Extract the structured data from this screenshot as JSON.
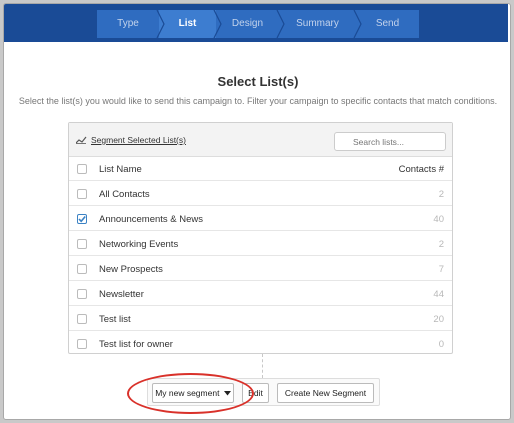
{
  "wizard": {
    "steps": [
      {
        "label": "Type"
      },
      {
        "label": "List"
      },
      {
        "label": "Design"
      },
      {
        "label": "Summary"
      },
      {
        "label": "Send"
      }
    ],
    "active_step": "List"
  },
  "page": {
    "title": "Select List(s)",
    "subtitle": "Select the list(s) you would like to send this campaign to. Filter your campaign to specific contacts that match conditions."
  },
  "panel": {
    "segment_link": "Segment Selected List(s)",
    "search_placeholder": "Search lists...",
    "columns": {
      "name": "List Name",
      "count": "Contacts #"
    },
    "rows": [
      {
        "name": "All Contacts",
        "count": "2",
        "checked": false
      },
      {
        "name": "Announcements & News",
        "count": "40",
        "checked": true
      },
      {
        "name": "Networking Events",
        "count": "2",
        "checked": false
      },
      {
        "name": "New Prospects",
        "count": "7",
        "checked": false
      },
      {
        "name": "Newsletter",
        "count": "44",
        "checked": false
      },
      {
        "name": "Test list",
        "count": "20",
        "checked": false
      },
      {
        "name": "Test list for owner",
        "count": "0",
        "checked": false
      }
    ]
  },
  "segment_bar": {
    "selected_segment": "My new segment",
    "edit_label": "Edit",
    "create_label": "Create New Segment"
  },
  "colors": {
    "topbar": "#1a4b96",
    "step": "#2f6cc0",
    "step_active": "#3d7dd0",
    "highlight_oval": "#d9312a"
  },
  "icons": {
    "segment": "segment-icon",
    "search": "search-icon",
    "check": "checkmark-icon",
    "caret": "caret-down-icon"
  }
}
